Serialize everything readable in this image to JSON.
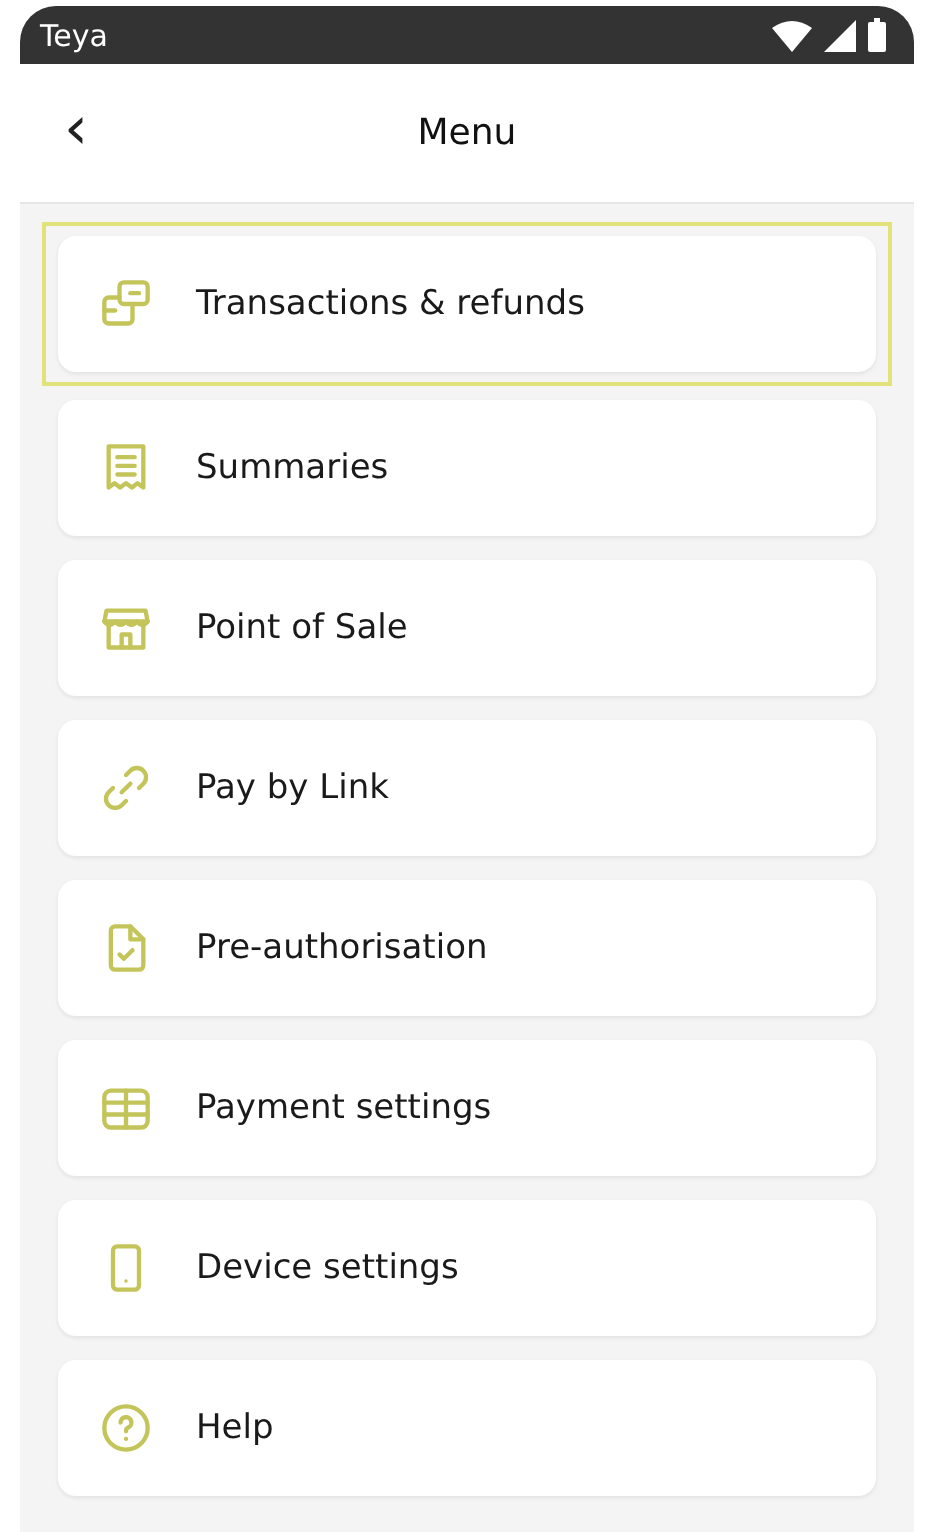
{
  "status_bar": {
    "app": "Teya"
  },
  "header": {
    "back": "‹",
    "title": "Menu"
  },
  "items": [
    {
      "label": "Transactions & refunds",
      "kind": "cards",
      "selected": true
    },
    {
      "label": "Summaries",
      "kind": "receipt",
      "selected": false
    },
    {
      "label": "Point of Sale",
      "kind": "store",
      "selected": false
    },
    {
      "label": "Pay by Link",
      "kind": "link",
      "selected": false
    },
    {
      "label": "Pre-authorisation",
      "kind": "doccheck",
      "selected": false
    },
    {
      "label": "Payment settings",
      "kind": "stack",
      "selected": false
    },
    {
      "label": "Device settings",
      "kind": "phone",
      "selected": false
    },
    {
      "label": "Help",
      "kind": "help",
      "selected": false
    }
  ]
}
